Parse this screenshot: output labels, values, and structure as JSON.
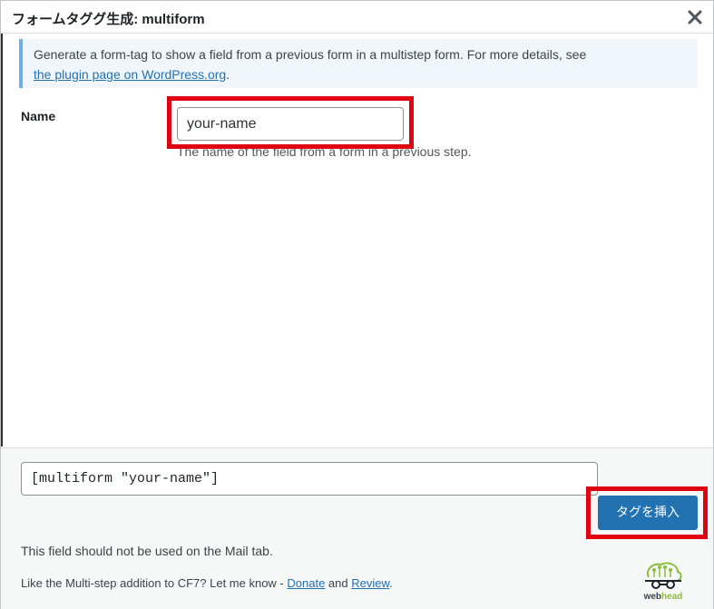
{
  "dialog": {
    "title": "フォームタググ生成: multiform",
    "close_icon": "close-icon"
  },
  "notice": {
    "text": "Generate a form-tag to show a field from a previous form in a multistep form. For more details, see",
    "link_text": "the plugin page on WordPress.org",
    "trailing": "."
  },
  "field": {
    "label": "Name",
    "value": "your-name",
    "help": "The name of the field from a form in a previous step."
  },
  "tag": {
    "value": "[multiform \"your-name\"]"
  },
  "buttons": {
    "insert_label": "タグを挿入"
  },
  "footer": {
    "warning": "This field should not be used on the Mail tab.",
    "promo_prefix": "Like the Multi-step addition to CF7? Let me know - ",
    "donate": "Donate",
    "and": " and ",
    "review": "Review",
    "suffix": "."
  },
  "logo": {
    "name": "webhead-logo",
    "text_web": "web",
    "text_head": "head"
  },
  "colors": {
    "highlight": "#e00012",
    "primary": "#2271b1",
    "notice_border": "#72aee6"
  }
}
